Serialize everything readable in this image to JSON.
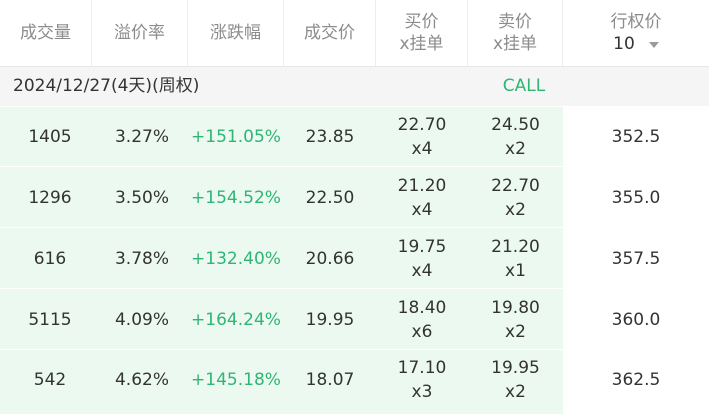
{
  "header": {
    "volume": "成交量",
    "premium": "溢价率",
    "change": "涨跌幅",
    "last": "成交价",
    "bid_line1": "买价",
    "bid_line2": "x挂单",
    "ask_line1": "卖价",
    "ask_line2": "x挂单",
    "strike_label": "行权价",
    "strike_count": "10"
  },
  "expiry": {
    "label": "2024/12/27(4天)(周权)",
    "side": "CALL"
  },
  "rows": [
    {
      "volume": "1405",
      "premium": "3.27%",
      "change": "+151.05%",
      "last": "23.85",
      "bid": "22.70",
      "bid_size": "x4",
      "ask": "24.50",
      "ask_size": "x2",
      "strike": "352.5"
    },
    {
      "volume": "1296",
      "premium": "3.50%",
      "change": "+154.52%",
      "last": "22.50",
      "bid": "21.20",
      "bid_size": "x4",
      "ask": "22.70",
      "ask_size": "x2",
      "strike": "355.0"
    },
    {
      "volume": "616",
      "premium": "3.78%",
      "change": "+132.40%",
      "last": "20.66",
      "bid": "19.75",
      "bid_size": "x4",
      "ask": "21.20",
      "ask_size": "x1",
      "strike": "357.5"
    },
    {
      "volume": "5115",
      "premium": "4.09%",
      "change": "+164.24%",
      "last": "19.95",
      "bid": "18.40",
      "bid_size": "x6",
      "ask": "19.80",
      "ask_size": "x2",
      "strike": "360.0"
    },
    {
      "volume": "542",
      "premium": "4.62%",
      "change": "+145.18%",
      "last": "18.07",
      "bid": "17.10",
      "bid_size": "x3",
      "ask": "19.95",
      "ask_size": "x2",
      "strike": "362.5"
    }
  ],
  "colors": {
    "up_green": "#2fb574",
    "call_bg": "#ecf9f1",
    "header_text": "#8c8c8c"
  }
}
